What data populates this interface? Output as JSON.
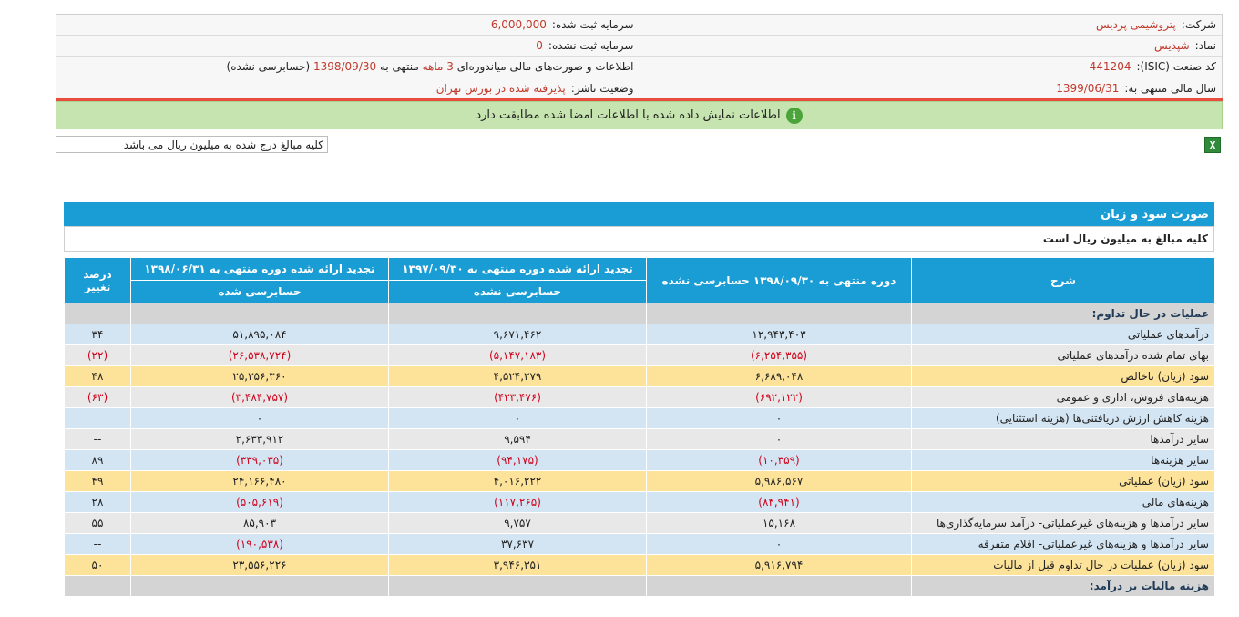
{
  "header": {
    "company_label": "شرکت:",
    "company_value": "پتروشیمی پردیس",
    "capital_label": "سرمایه ثبت شده:",
    "capital_value": "6,000,000",
    "symbol_label": "نماد:",
    "symbol_value": "شپدیس",
    "unregistered_capital_label": "سرمایه ثبت نشده:",
    "unregistered_capital_value": "0",
    "isic_label": "کد صنعت (ISIC):",
    "isic_value": "441204",
    "report_prefix": "اطلاعات و صورت‌های مالی میاندوره‌ای",
    "report_period": "3 ماهه",
    "report_mid": "منتهی به",
    "report_date": "1398/09/30",
    "report_suffix": "(حسابرسی نشده)",
    "fiscal_label": "سال مالی منتهی به:",
    "fiscal_value": "1399/06/31",
    "status_label": "وضعیت ناشر:",
    "status_value": "پذیرفته شده در بورس تهران"
  },
  "notice": {
    "text": "اطلاعات نمایش داده شده با اطلاعات امضا شده مطابقت دارد",
    "icon": "info-icon"
  },
  "amounts_note": "کلیه مبالغ درج شده به میلیون ریال می باشد",
  "excel_icon": "excel-export-icon",
  "statement": {
    "title": "صورت سود و زیان",
    "unit_note": "کلیه مبالغ به میلیون ریال است",
    "columns": {
      "desc": "شرح",
      "current": "دوره منتهی به ۱۳۹۸/۰۹/۳۰ حسابرسی نشده",
      "prev_period": "تجدید ارائه شده دوره منتهی به ۱۳۹۷/۰۹/۳۰",
      "prev_period_sub": "حسابرسی نشده",
      "prev_year": "تجدید ارائه شده دوره منتهی به ۱۳۹۸/۰۶/۳۱",
      "prev_year_sub": "حسابرسی شده",
      "change": "درصد تغییر"
    },
    "section_ops": "عملیات در حال تداوم:",
    "rows": [
      {
        "desc": "درآمدهای عملیاتی",
        "current": "۱۲,۹۴۳,۴۰۳",
        "prev_period": "۹,۶۷۱,۴۶۲",
        "prev_year": "۵۱,۸۹۵,۰۸۴",
        "change": "۳۴"
      },
      {
        "desc": "بهای تمام شده درآمدهای عملیاتی",
        "current": "(۶,۲۵۴,۳۵۵)",
        "prev_period": "(۵,۱۴۷,۱۸۳)",
        "prev_year": "(۲۶,۵۳۸,۷۲۴)",
        "change": "(۲۲)"
      },
      {
        "desc": "سود (زیان) ناخالص",
        "current": "۶,۶۸۹,۰۴۸",
        "prev_period": "۴,۵۲۴,۲۷۹",
        "prev_year": "۲۵,۳۵۶,۳۶۰",
        "change": "۴۸"
      },
      {
        "desc": "هزینه‌های فروش، اداری و عمومی",
        "current": "(۶۹۲,۱۲۲)",
        "prev_period": "(۴۲۳,۴۷۶)",
        "prev_year": "(۳,۴۸۴,۷۵۷)",
        "change": "(۶۳)"
      },
      {
        "desc": "هزینه کاهش ارزش دریافتنی‌ها (هزینه استثنایی)",
        "current": "۰",
        "prev_period": "۰",
        "prev_year": "۰",
        "change": ""
      },
      {
        "desc": "سایر درآمدها",
        "current": "۰",
        "prev_period": "۹,۵۹۴",
        "prev_year": "۲,۶۳۳,۹۱۲",
        "change": "--"
      },
      {
        "desc": "سایر هزینه‌ها",
        "current": "(۱۰,۳۵۹)",
        "prev_period": "(۹۴,۱۷۵)",
        "prev_year": "(۳۳۹,۰۳۵)",
        "change": "۸۹"
      },
      {
        "desc": "سود (زیان) عملیاتی",
        "current": "۵,۹۸۶,۵۶۷",
        "prev_period": "۴,۰۱۶,۲۲۲",
        "prev_year": "۲۴,۱۶۶,۴۸۰",
        "change": "۴۹"
      },
      {
        "desc": "هزینه‌های مالی",
        "current": "(۸۴,۹۴۱)",
        "prev_period": "(۱۱۷,۲۶۵)",
        "prev_year": "(۵۰۵,۶۱۹)",
        "change": "۲۸"
      },
      {
        "desc": "سایر درآمدها و هزینه‌های غیرعملیاتی- درآمد سرمایه‌گذاری‌ها",
        "current": "۱۵,۱۶۸",
        "prev_period": "۹,۷۵۷",
        "prev_year": "۸۵,۹۰۳",
        "change": "۵۵"
      },
      {
        "desc": "سایر درآمدها و هزینه‌های غیرعملیاتی- اقلام متفرقه",
        "current": "۰",
        "prev_period": "۳۷,۶۳۷",
        "prev_year": "(۱۹۰,۵۳۸)",
        "change": "--"
      },
      {
        "desc": "سود (زیان) عملیات در حال تداوم قبل از مالیات",
        "current": "۵,۹۱۶,۷۹۴",
        "prev_period": "۳,۹۴۶,۳۵۱",
        "prev_year": "۲۳,۵۵۶,۲۲۶",
        "change": "۵۰"
      }
    ],
    "section_tax": "هزینه مالیات بر درآمد:"
  }
}
